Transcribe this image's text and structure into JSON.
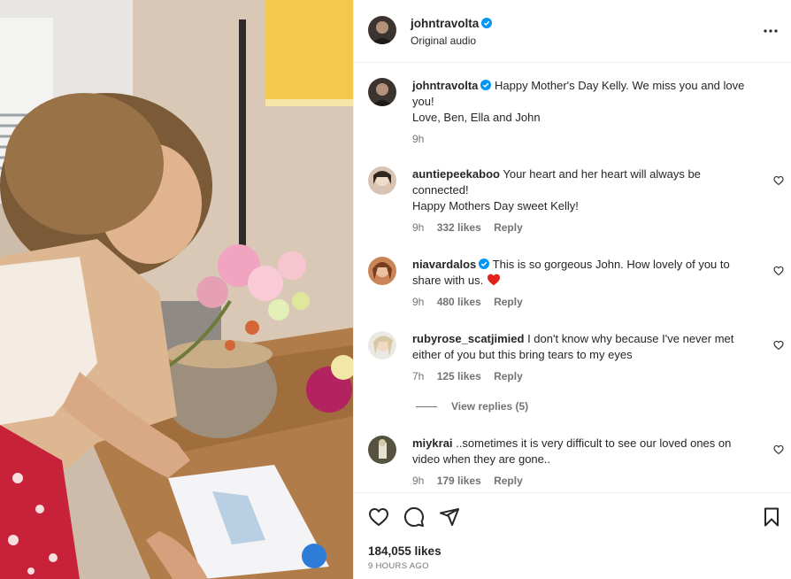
{
  "post": {
    "author": "johntravolta",
    "audio": "Original audio",
    "caption_line1": "Happy Mother's Day Kelly. We miss you and love",
    "caption_line2": "you!",
    "caption_line3": "Love, Ben, Ella and John",
    "caption_time": "9h"
  },
  "comments": [
    {
      "username": "auntiepeekaboo",
      "line1": "Your heart and her heart will always be",
      "line2": "connected!",
      "line3": "Happy Mothers Day sweet Kelly!",
      "time": "9h",
      "likes": "332 likes",
      "reply": "Reply"
    },
    {
      "username": "niavardalos",
      "line1": "This is so gorgeous John. How lovely of you to",
      "line2": "share with us.",
      "time": "9h",
      "likes": "480 likes",
      "reply": "Reply"
    },
    {
      "username": "rubyrose_scatjimied",
      "line1": "I don't know why because I've never met",
      "line2": "either of you but this bring tears to my eyes",
      "time": "7h",
      "likes": "125 likes",
      "reply": "Reply"
    },
    {
      "username": "miykrai",
      "line1": "..sometimes it is very difficult to see our loved ones on",
      "line2": "video when they are gone..",
      "time": "9h",
      "likes": "179 likes",
      "reply": "Reply"
    }
  ],
  "view_replies": "View replies (5)",
  "footer": {
    "likes": "184,055 likes",
    "time_ago": "9 HOURS AGO"
  },
  "icons": {
    "like": "heart-icon",
    "comment": "comment-icon",
    "share": "share-icon",
    "save": "bookmark-icon",
    "more": "more-icon",
    "verified": "verified-badge-icon"
  },
  "colors": {
    "verified": "#0095f6",
    "heart_emoji": "#e0241b",
    "muted": "#737373"
  }
}
